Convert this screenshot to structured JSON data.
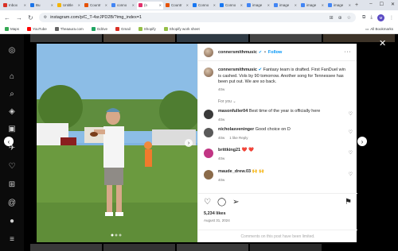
{
  "browser": {
    "tabs": [
      {
        "label": "Inbox",
        "color": "#d93025"
      },
      {
        "label": "Bu",
        "color": "#1a73e8"
      },
      {
        "label": "Untitle",
        "color": "#f4b400"
      },
      {
        "label": "Countr",
        "color": "#e65100"
      },
      {
        "label": "conno",
        "color": "#4285f4"
      },
      {
        "label": "(n",
        "color": "#e1306c",
        "active": true
      },
      {
        "label": "Countr",
        "color": "#e65100"
      },
      {
        "label": "Conno",
        "color": "#1877f2"
      },
      {
        "label": "Conno",
        "color": "#1877f2"
      },
      {
        "label": "image",
        "color": "#4285f4"
      },
      {
        "label": "image",
        "color": "#4285f4"
      },
      {
        "label": "image",
        "color": "#4285f4"
      },
      {
        "label": "image",
        "color": "#4285f4"
      }
    ],
    "new_tab": "+",
    "url": "instagram.com/p/C_T-4srJPD2B/?img_index=1",
    "profile_initial": "M",
    "bookmarks": [
      {
        "label": "Maps",
        "color": "#34a853"
      },
      {
        "label": "YouTube",
        "color": "#ff0000"
      },
      {
        "label": "Theaaura.com",
        "color": "#666666"
      },
      {
        "label": "Gdrive",
        "color": "#1fa463"
      },
      {
        "label": "Gmail",
        "color": "#d93025"
      },
      {
        "label": "Shopify",
        "color": "#95bf47"
      },
      {
        "label": "Shopify work sheet",
        "color": "#95bf47"
      }
    ],
    "all_bookmarks": "All Bookmarks"
  },
  "post": {
    "username": "connersmithmusic",
    "follow_label": "Follow",
    "caption": "Fantasy team is drafted. First FanDuel win is cashed. Vols by 90 tomorrow. Another song for Tennessee has been put out. We are so back.",
    "caption_time": "40w",
    "for_you_label": "For you",
    "comments": [
      {
        "user": "masonfuller04",
        "text": "Best time of the year is officially here",
        "time": "40w",
        "avatar_color": "#3a3a3a"
      },
      {
        "user": "nicholasveninger",
        "text": "Good choice on D",
        "time": "40w",
        "reply": "1 like  Reply",
        "avatar_color": "#5a5a5a"
      },
      {
        "user": "brittking21",
        "text": "❤️ ❤️",
        "time": "40w",
        "avatar_color": "#c13584"
      },
      {
        "user": "maude_drew.03",
        "text": "🙌 🙌",
        "time": "40w",
        "avatar_color": "#8b6b4a"
      }
    ],
    "likes": "5,234 likes",
    "date": "August 31, 2024",
    "comments_limited": "Comments on this post have been limited."
  }
}
